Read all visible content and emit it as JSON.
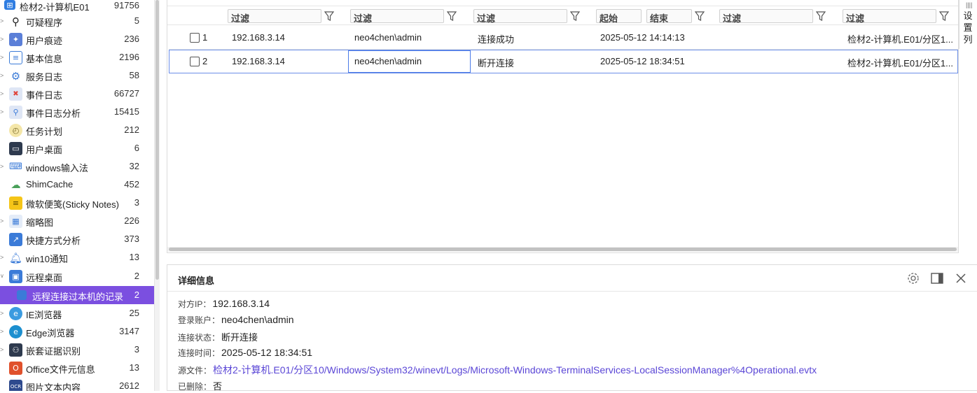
{
  "sidebar": {
    "items": [
      {
        "label": "检材2-计算机E01",
        "count": "91756",
        "icon": "windows-icon"
      },
      {
        "label": "可疑程序",
        "count": "5",
        "icon": "search-icon"
      },
      {
        "label": "用户痕迹",
        "count": "236",
        "icon": "footprint-icon"
      },
      {
        "label": "基本信息",
        "count": "2196",
        "icon": "list-icon"
      },
      {
        "label": "服务日志",
        "count": "58",
        "icon": "gear-icon"
      },
      {
        "label": "事件日志",
        "count": "66727",
        "icon": "event-log-icon"
      },
      {
        "label": "事件日志分析",
        "count": "15415",
        "icon": "log-analysis-icon"
      },
      {
        "label": "任务计划",
        "count": "212",
        "icon": "clock-icon"
      },
      {
        "label": "用户桌面",
        "count": "6",
        "icon": "monitor-icon"
      },
      {
        "label": "windows输入法",
        "count": "32",
        "icon": "keyboard-icon"
      },
      {
        "label": "ShimCache",
        "count": "452",
        "icon": "cache-icon"
      },
      {
        "label": "微软便笺(Sticky Notes)",
        "count": "3",
        "icon": "sticky-note-icon"
      },
      {
        "label": "缩略图",
        "count": "226",
        "icon": "thumbnail-icon"
      },
      {
        "label": "快捷方式分析",
        "count": "373",
        "icon": "shortcut-icon"
      },
      {
        "label": "win10通知",
        "count": "13",
        "icon": "bell-icon"
      },
      {
        "label": "远程桌面",
        "count": "2",
        "icon": "remote-desktop-icon"
      },
      {
        "label": "远程连接过本机的记录",
        "count": "2",
        "icon": "record-icon"
      },
      {
        "label": "IE浏览器",
        "count": "25",
        "icon": "ie-icon"
      },
      {
        "label": "Edge浏览器",
        "count": "3147",
        "icon": "edge-icon"
      },
      {
        "label": "嵌套证据识别",
        "count": "3",
        "icon": "nested-evidence-icon"
      },
      {
        "label": "Office文件元信息",
        "count": "13",
        "icon": "office-icon"
      },
      {
        "label": "图片文本内容",
        "count": "2612",
        "icon": "ocr-icon"
      }
    ]
  },
  "grid": {
    "filters": {
      "placeholder": "过滤",
      "start": "起始",
      "end": "结束"
    },
    "rows": [
      {
        "index": "1",
        "ip": "192.168.3.14",
        "account": "neo4chen\\admin",
        "status": "连接成功",
        "time": "2025-05-12 14:14:13",
        "source": "检材2-计算机.E01/分区1..."
      },
      {
        "index": "2",
        "ip": "192.168.3.14",
        "account": "neo4chen\\admin",
        "status": "断开连接",
        "time": "2025-05-12 18:34:51",
        "source": "检材2-计算机.E01/分区1..."
      }
    ],
    "column_settings_label": "设置列"
  },
  "details": {
    "title": "详细信息",
    "fields": [
      {
        "key": "对方IP：",
        "value": "192.168.3.14"
      },
      {
        "key": "登录账户：",
        "value": "neo4chen\\admin"
      },
      {
        "key": "连接状态：",
        "value": "断开连接"
      },
      {
        "key": "连接时间：",
        "value": "2025-05-12 18:34:51"
      },
      {
        "key": "源文件：",
        "value": "检材2-计算机.E01/分区10/Windows/System32/winevt/Logs/Microsoft-Windows-TerminalServices-LocalSessionManager%4Operational.evtx"
      },
      {
        "key": "已删除：",
        "value": "否"
      }
    ]
  },
  "colors": {
    "accent": "#7b4fe0",
    "link": "#5a46d6",
    "selection_border": "#6b8ee8"
  }
}
